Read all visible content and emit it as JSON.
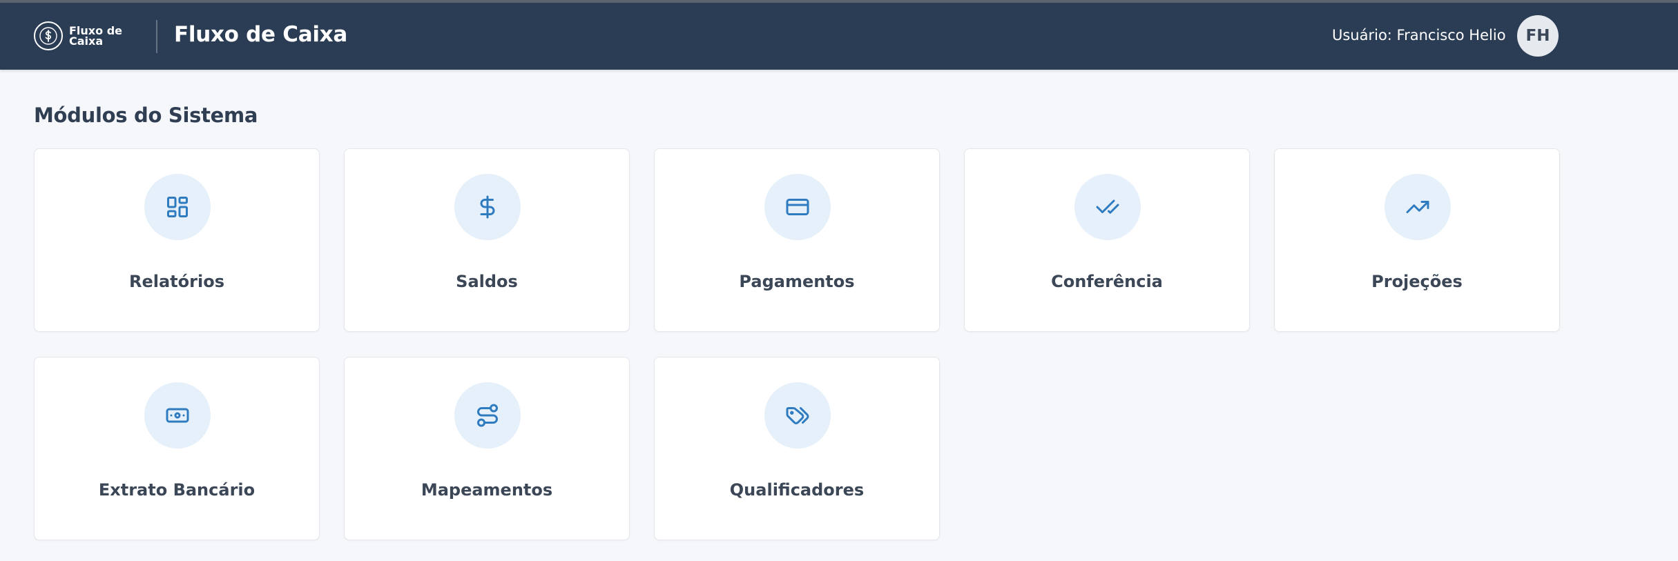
{
  "header": {
    "logo_text": "Fluxo de Caixa",
    "app_title": "Fluxo de Caixa",
    "user_label": "Usuário: Francisco Helio",
    "avatar_initials": "FH",
    "background_color": "#2b3d55"
  },
  "main": {
    "section_title": "Módulos do Sistema",
    "modules": [
      {
        "label": "Relatórios",
        "icon": "dashboard-grid-icon"
      },
      {
        "label": "Saldos",
        "icon": "dollar-sign-icon"
      },
      {
        "label": "Pagamentos",
        "icon": "credit-card-icon"
      },
      {
        "label": "Conferência",
        "icon": "double-check-icon"
      },
      {
        "label": "Projeções",
        "icon": "trending-up-icon"
      },
      {
        "label": "Extrato Bancário",
        "icon": "banknote-icon"
      },
      {
        "label": "Mapeamentos",
        "icon": "route-icon"
      },
      {
        "label": "Qualificadores",
        "icon": "tags-icon"
      }
    ]
  },
  "colors": {
    "accent": "#2f7bbf",
    "icon_bg": "#e5f0fa",
    "page_bg": "#f5f7fa"
  }
}
